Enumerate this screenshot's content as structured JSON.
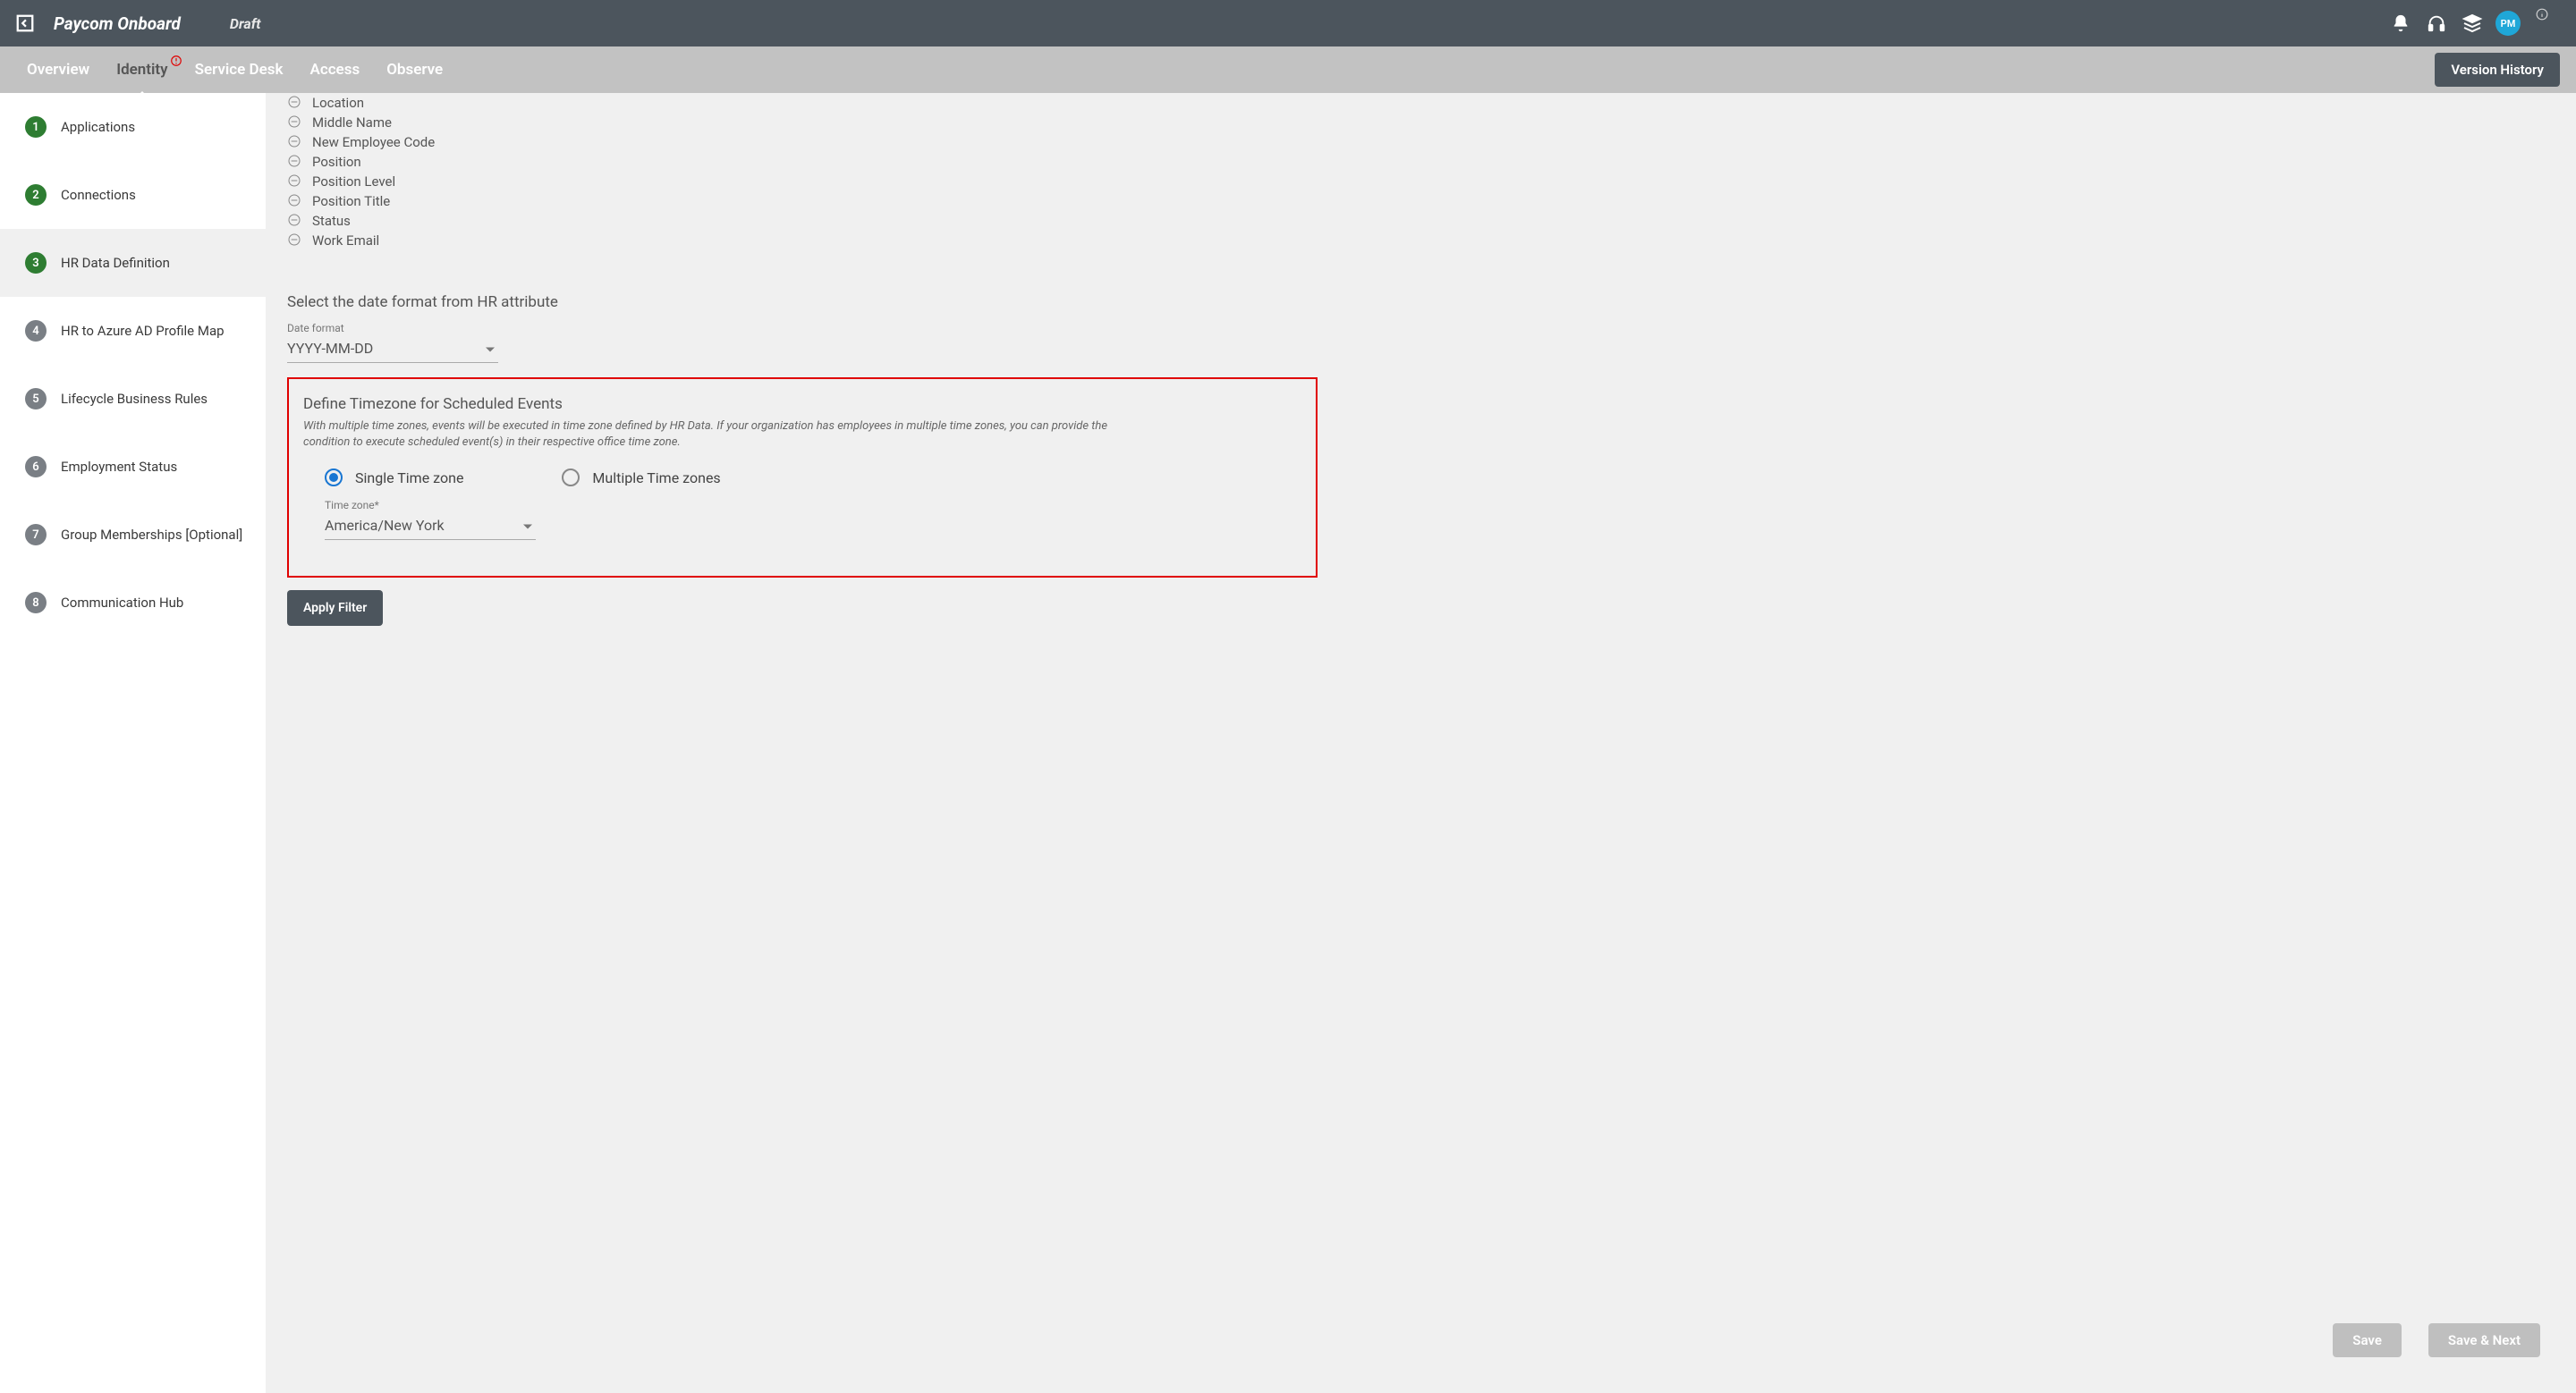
{
  "header": {
    "title": "Paycom Onboard",
    "status": "Draft",
    "avatar_initials": "PM"
  },
  "tabs": {
    "overview": "Overview",
    "identity": "Identity",
    "service_desk": "Service Desk",
    "access": "Access",
    "observe": "Observe",
    "version_history": "Version History"
  },
  "sidebar_steps": [
    {
      "num": "1",
      "label": "Applications",
      "color": "green"
    },
    {
      "num": "2",
      "label": "Connections",
      "color": "green"
    },
    {
      "num": "3",
      "label": "HR Data Definition",
      "color": "green",
      "active": true
    },
    {
      "num": "4",
      "label": "HR to Azure AD Profile Map",
      "color": "grey"
    },
    {
      "num": "5",
      "label": "Lifecycle Business Rules",
      "color": "grey"
    },
    {
      "num": "6",
      "label": "Employment Status",
      "color": "grey"
    },
    {
      "num": "7",
      "label": "Group Memberships [Optional]",
      "color": "grey"
    },
    {
      "num": "8",
      "label": "Communication Hub",
      "color": "grey"
    }
  ],
  "attributes": [
    "Location",
    "Middle Name",
    "New Employee Code",
    "Position",
    "Position Level",
    "Position Title",
    "Status",
    "Work Email"
  ],
  "date_section": {
    "heading": "Select the date format from HR attribute",
    "field_label": "Date format",
    "value": "YYYY-MM-DD"
  },
  "timezone_section": {
    "title": "Define Timezone for Scheduled Events",
    "description": "With multiple time zones, events will be executed in time zone defined by HR Data. If your organization has employees in multiple time zones, you can provide the condition to execute scheduled event(s) in their respective office time zone.",
    "opt_single": "Single Time zone",
    "opt_multiple": "Multiple Time zones",
    "tz_field_label": "Time zone*",
    "tz_value": "America/New York"
  },
  "buttons": {
    "apply_filter": "Apply Filter",
    "save": "Save",
    "save_next": "Save & Next"
  }
}
